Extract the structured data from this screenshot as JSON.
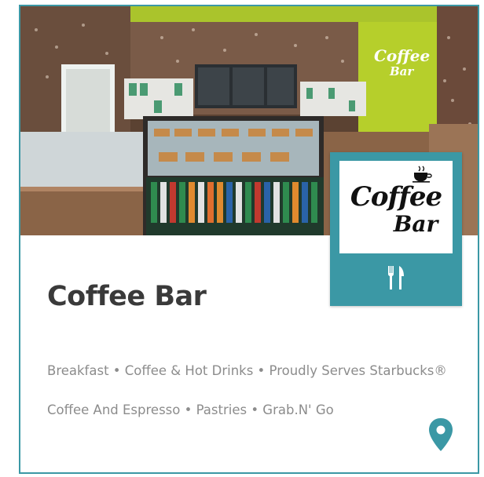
{
  "card": {
    "name": "Coffee Bar",
    "categories_line1": "Breakfast • Coffee & Hot Drinks • Proudly Serves Starbucks®",
    "categories_line2": "Coffee And Espresso • Pastries • Grab.N' Go",
    "logo_line1": "Coffee",
    "logo_line2": "Bar",
    "icons": {
      "restaurant": "fork-knife-icon",
      "location": "map-pin-icon"
    }
  },
  "hero_wall_sign": {
    "line1": "Coffee",
    "line2": "Bar"
  },
  "colors": {
    "accent": "#3b98a5",
    "title": "#3a3a3a",
    "text_muted": "#8c8c8c",
    "wall_green": "#b6cf2b"
  }
}
